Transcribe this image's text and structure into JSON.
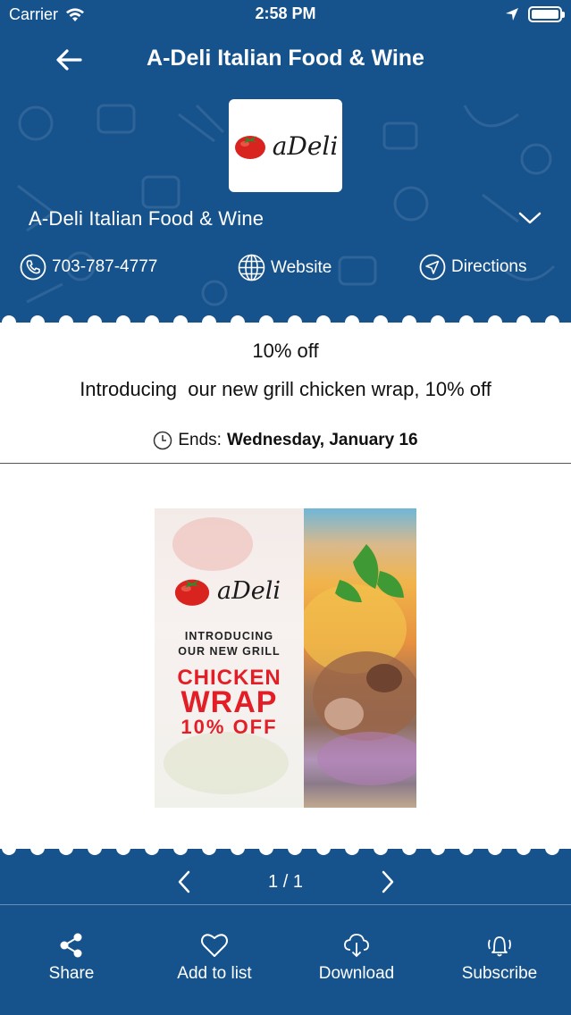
{
  "status_bar": {
    "carrier": "Carrier",
    "time": "2:58 PM"
  },
  "nav": {
    "title": "A-Deli Italian Food & Wine",
    "back_icon": "arrow-left-icon"
  },
  "store": {
    "logo_text": "aDeli",
    "name": "A-Deli Italian Food & Wine",
    "phone": "703-787-4777",
    "website_label": "Website",
    "directions_label": "Directions"
  },
  "deal": {
    "title": "10% off",
    "description": "Introducing  our new grill chicken wrap, 10% off",
    "ends_label": "Ends:",
    "ends_date": "Wednesday, January 16"
  },
  "promo": {
    "logo_text": "aDeli",
    "intro": "INTRODUCING\nOUR NEW GRILL",
    "line1": "CHICKEN",
    "line2": "WRAP",
    "line3": "10% OFF"
  },
  "pager": {
    "label": "1 / 1"
  },
  "tabs": [
    {
      "label": "Share",
      "icon": "share-icon"
    },
    {
      "label": "Add to list",
      "icon": "heart-icon"
    },
    {
      "label": "Download",
      "icon": "cloud-download-icon"
    },
    {
      "label": "Subscribe",
      "icon": "bell-ringing-icon"
    }
  ],
  "colors": {
    "primary": "#16528c",
    "accent_red": "#e41e26",
    "card": "#ffffff"
  }
}
